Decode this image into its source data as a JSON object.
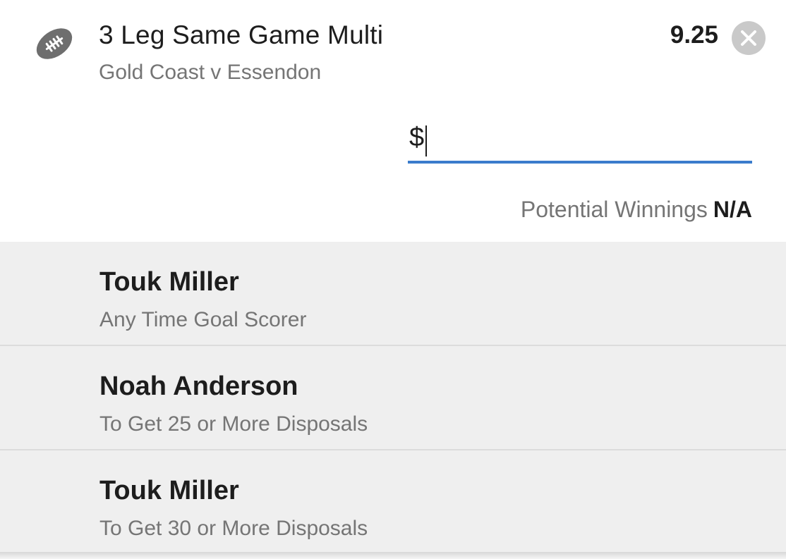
{
  "bet": {
    "title": "3 Leg Same Game Multi",
    "match": "Gold Coast v Essendon",
    "odds": "9.25",
    "sport_icon": "football-icon",
    "close_icon": "close-icon"
  },
  "stake": {
    "prefix": "$",
    "value": ""
  },
  "winnings": {
    "label": "Potential Winnings",
    "value": "N/A"
  },
  "legs": [
    {
      "player": "Touk Miller",
      "market": "Any Time Goal Scorer"
    },
    {
      "player": "Noah Anderson",
      "market": "To Get 25 or More Disposals"
    },
    {
      "player": "Touk Miller",
      "market": "To Get 30 or More Disposals"
    }
  ],
  "colors": {
    "accent": "#3a7ccc",
    "text_primary": "#1d1d1d",
    "text_secondary": "#757575",
    "legs_background": "#efefef",
    "close_button": "#c9c9c9"
  }
}
